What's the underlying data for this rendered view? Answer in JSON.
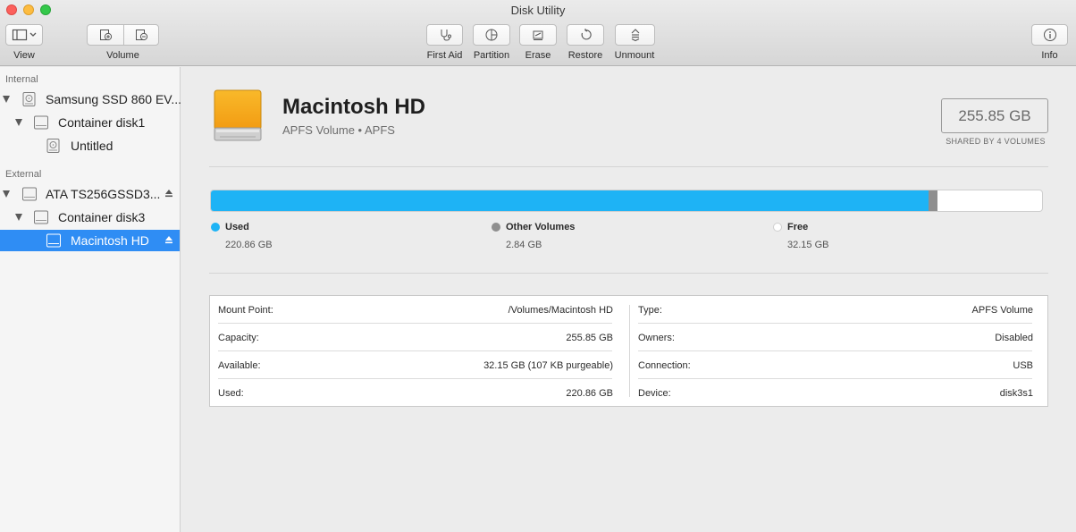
{
  "window": {
    "title": "Disk Utility"
  },
  "toolbar": {
    "view_label": "View",
    "volume_label": "Volume",
    "first_aid_label": "First Aid",
    "partition_label": "Partition",
    "erase_label": "Erase",
    "restore_label": "Restore",
    "unmount_label": "Unmount",
    "info_label": "Info"
  },
  "sidebar": {
    "internal_header": "Internal",
    "external_header": "External",
    "items": [
      {
        "label": "Samsung SSD 860 EV..."
      },
      {
        "label": "Container disk1"
      },
      {
        "label": "Untitled"
      },
      {
        "label": "ATA TS256GSSD3..."
      },
      {
        "label": "Container disk3"
      },
      {
        "label": "Macintosh HD"
      }
    ]
  },
  "volume": {
    "name": "Macintosh HD",
    "subtitle": "APFS Volume • APFS",
    "capacity": "255.85 GB",
    "shared_note": "SHARED BY 4 VOLUMES"
  },
  "usage": {
    "used_fraction": 0.8632,
    "other_fraction": 0.0111,
    "colors": {
      "used": "#1eb3f5",
      "other": "#8f8f8f",
      "free": "#ffffff"
    },
    "legend": [
      {
        "name": "Used",
        "value": "220.86 GB"
      },
      {
        "name": "Other Volumes",
        "value": "2.84 GB"
      },
      {
        "name": "Free",
        "value": "32.15 GB"
      }
    ]
  },
  "info": {
    "left": [
      {
        "key": "Mount Point:",
        "value": "/Volumes/Macintosh HD"
      },
      {
        "key": "Capacity:",
        "value": "255.85 GB"
      },
      {
        "key": "Available:",
        "value": "32.15 GB (107 KB purgeable)"
      },
      {
        "key": "Used:",
        "value": "220.86 GB"
      }
    ],
    "right": [
      {
        "key": "Type:",
        "value": "APFS Volume"
      },
      {
        "key": "Owners:",
        "value": "Disabled"
      },
      {
        "key": "Connection:",
        "value": "USB"
      },
      {
        "key": "Device:",
        "value": "disk3s1"
      }
    ]
  }
}
